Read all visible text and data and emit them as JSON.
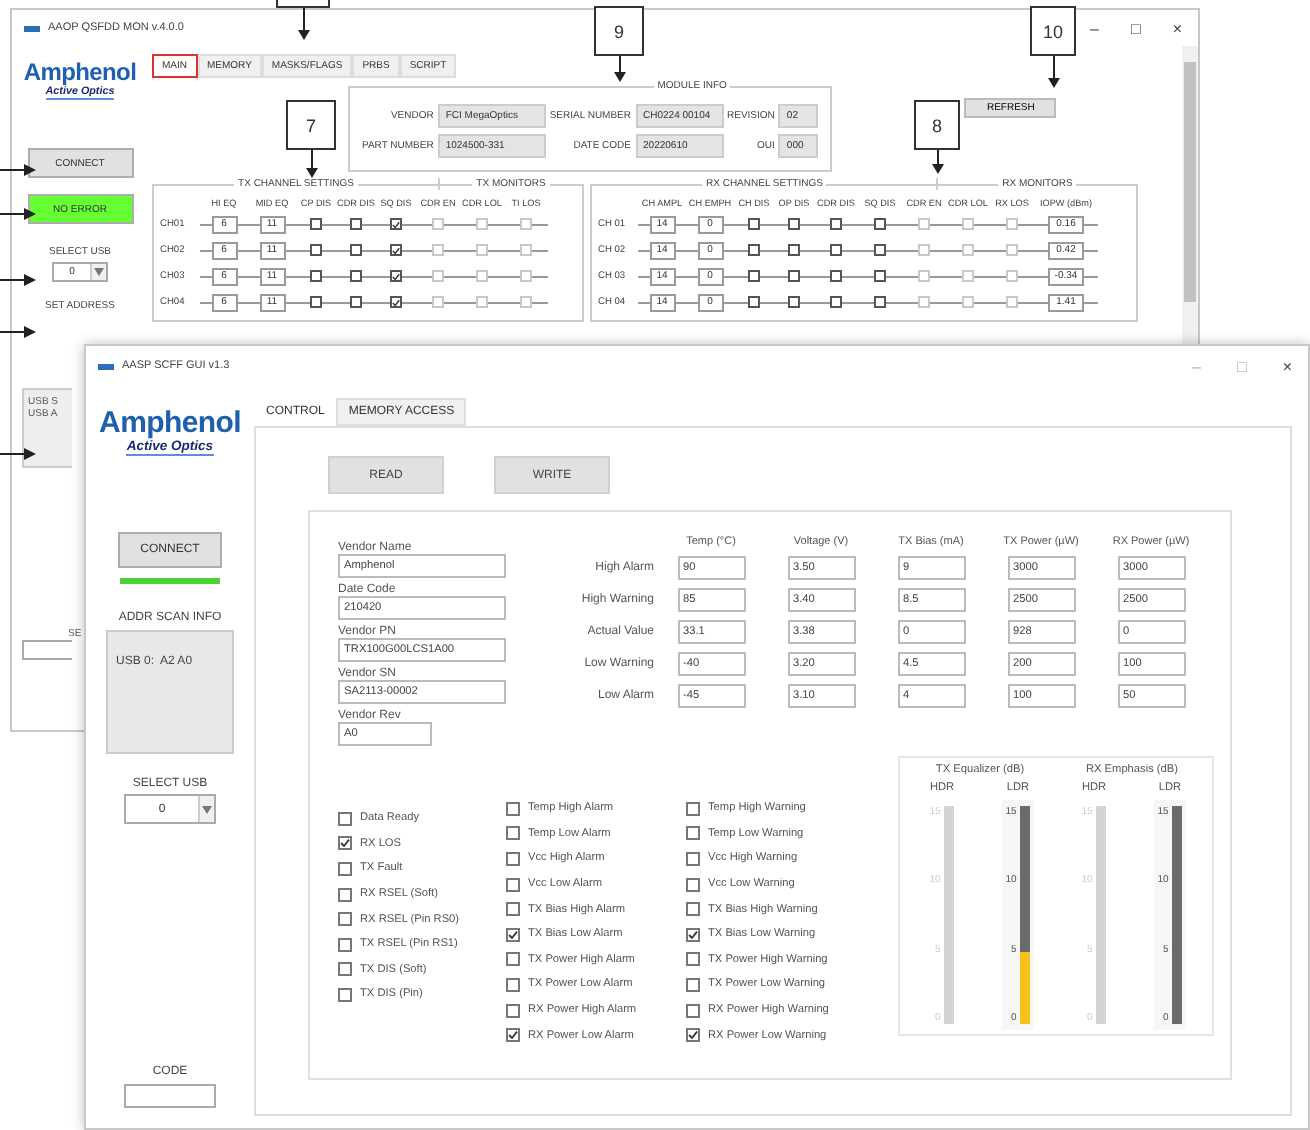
{
  "callouts": [
    {
      "kind": "partial"
    },
    {
      "kind": "numbered",
      "label": "9"
    },
    {
      "kind": "numbered",
      "label": "7"
    },
    {
      "kind": "numbered",
      "label": "8"
    },
    {
      "kind": "numbered",
      "label": "10"
    }
  ],
  "main_window": {
    "title": "AAOP QSFDD MON v.4.0.0",
    "controls": [
      "–",
      "□",
      "×"
    ],
    "logo": {
      "name": "Amphenol",
      "tagline": "Active Optics"
    },
    "tabs": [
      {
        "label": "MAIN",
        "selected": true
      },
      {
        "label": "MEMORY",
        "selected": false
      },
      {
        "label": "MASKS/FLAGS",
        "selected": false
      },
      {
        "label": "PRBS",
        "selected": false
      },
      {
        "label": "SCRIPT",
        "selected": false
      }
    ],
    "sidebar": {
      "connect": "CONNECT",
      "status": {
        "label": "NO ERROR",
        "ok": true
      },
      "select_usb": "SELECT USB",
      "usb_value": "0",
      "set_address": "SET ADDRESS",
      "scan_lines": [
        "USB S",
        "USB A"
      ],
      "cut_label": "SE"
    },
    "module_info": {
      "title": "MODULE INFO",
      "rows": [
        [
          {
            "label": "VENDOR",
            "value": "FCI MegaOptics"
          },
          {
            "label": "SERIAL NUMBER",
            "value": "CH0224 00104"
          },
          {
            "label": "REVISION",
            "value": "02"
          }
        ],
        [
          {
            "label": "PART NUMBER",
            "value": "1024500-331"
          },
          {
            "label": "DATE CODE",
            "value": "20220610"
          },
          {
            "label": "OUI",
            "value": "000"
          }
        ]
      ]
    },
    "refresh": "REFRESH",
    "tx": {
      "settings_title": "TX CHANNEL SETTINGS",
      "monitors_title": "TX MONITORS",
      "headers": [
        "HI EQ",
        "MID EQ",
        "CP DIS",
        "CDR DIS",
        "SQ DIS",
        "CDR EN",
        "CDR LOL",
        "TI LOS"
      ],
      "rows": [
        {
          "channel": "CH01",
          "cells": [
            {
              "kind": "value",
              "text": "6"
            },
            {
              "kind": "value",
              "text": "11"
            },
            {
              "kind": "check",
              "checked": false
            },
            {
              "kind": "check",
              "checked": false
            },
            {
              "kind": "check",
              "checked": true
            },
            {
              "kind": "led",
              "on": false
            },
            {
              "kind": "led",
              "on": false
            },
            {
              "kind": "led",
              "on": false
            }
          ]
        },
        {
          "channel": "CH02",
          "cells": [
            {
              "kind": "value",
              "text": "6"
            },
            {
              "kind": "value",
              "text": "11"
            },
            {
              "kind": "check",
              "checked": false
            },
            {
              "kind": "check",
              "checked": false
            },
            {
              "kind": "check",
              "checked": true
            },
            {
              "kind": "led",
              "on": false
            },
            {
              "kind": "led",
              "on": false
            },
            {
              "kind": "led",
              "on": false
            }
          ]
        },
        {
          "channel": "CH03",
          "cells": [
            {
              "kind": "value",
              "text": "6"
            },
            {
              "kind": "value",
              "text": "11"
            },
            {
              "kind": "check",
              "checked": false
            },
            {
              "kind": "check",
              "checked": false
            },
            {
              "kind": "check",
              "checked": true
            },
            {
              "kind": "led",
              "on": false
            },
            {
              "kind": "led",
              "on": false
            },
            {
              "kind": "led",
              "on": false
            }
          ]
        },
        {
          "channel": "CH04",
          "cells": [
            {
              "kind": "value",
              "text": "6"
            },
            {
              "kind": "value",
              "text": "11"
            },
            {
              "kind": "check",
              "checked": false
            },
            {
              "kind": "check",
              "checked": false
            },
            {
              "kind": "check",
              "checked": true
            },
            {
              "kind": "led",
              "on": false
            },
            {
              "kind": "led",
              "on": false
            },
            {
              "kind": "led",
              "on": false
            }
          ]
        }
      ]
    },
    "rx": {
      "settings_title": "RX CHANNEL SETTINGS",
      "monitors_title": "RX MONITORS",
      "headers": [
        "CH AMPL",
        "CH EMPH",
        "CH DIS",
        "OP DIS",
        "CDR DIS",
        "SQ DIS",
        "CDR EN",
        "CDR LOL",
        "RX LOS",
        "IOPW (dBm)"
      ],
      "rows": [
        {
          "channel": "CH 01",
          "cells": [
            {
              "kind": "value",
              "text": "14"
            },
            {
              "kind": "value",
              "text": "0"
            },
            {
              "kind": "check",
              "checked": false
            },
            {
              "kind": "check",
              "checked": false
            },
            {
              "kind": "check",
              "checked": false
            },
            {
              "kind": "check",
              "checked": false
            },
            {
              "kind": "led",
              "on": false
            },
            {
              "kind": "led",
              "on": false
            },
            {
              "kind": "led",
              "on": false
            },
            {
              "kind": "reading",
              "text": "0.16"
            }
          ]
        },
        {
          "channel": "CH 02",
          "cells": [
            {
              "kind": "value",
              "text": "14"
            },
            {
              "kind": "value",
              "text": "0"
            },
            {
              "kind": "check",
              "checked": false
            },
            {
              "kind": "check",
              "checked": false
            },
            {
              "kind": "check",
              "checked": false
            },
            {
              "kind": "check",
              "checked": false
            },
            {
              "kind": "led",
              "on": false
            },
            {
              "kind": "led",
              "on": false
            },
            {
              "kind": "led",
              "on": false
            },
            {
              "kind": "reading",
              "text": "0.42"
            }
          ]
        },
        {
          "channel": "CH 03",
          "cells": [
            {
              "kind": "value",
              "text": "14"
            },
            {
              "kind": "value",
              "text": "0"
            },
            {
              "kind": "check",
              "checked": false
            },
            {
              "kind": "check",
              "checked": false
            },
            {
              "kind": "check",
              "checked": false
            },
            {
              "kind": "check",
              "checked": false
            },
            {
              "kind": "led",
              "on": false
            },
            {
              "kind": "led",
              "on": false
            },
            {
              "kind": "led",
              "on": false
            },
            {
              "kind": "reading",
              "text": "-0.34"
            }
          ]
        },
        {
          "channel": "CH 04",
          "cells": [
            {
              "kind": "value",
              "text": "14"
            },
            {
              "kind": "value",
              "text": "0"
            },
            {
              "kind": "check",
              "checked": false
            },
            {
              "kind": "check",
              "checked": false
            },
            {
              "kind": "check",
              "checked": false
            },
            {
              "kind": "check",
              "checked": false
            },
            {
              "kind": "led",
              "on": false
            },
            {
              "kind": "led",
              "on": false
            },
            {
              "kind": "led",
              "on": false
            },
            {
              "kind": "reading",
              "text": "1.41"
            }
          ]
        }
      ]
    }
  },
  "scff_window": {
    "title": "AASP SCFF GUI v1.3",
    "controls": [
      "–",
      "□",
      "×"
    ],
    "logo": {
      "name": "Amphenol",
      "tagline": "Active Optics"
    },
    "connect": "CONNECT",
    "connected": true,
    "scan_title": "ADDR SCAN INFO",
    "scan_text": "USB 0:  A2 A0",
    "select_usb": "SELECT USB",
    "usb_value": "0",
    "code_label": "CODE",
    "tabs": [
      {
        "label": "CONTROL",
        "selected": true
      },
      {
        "label": "MEMORY ACCESS",
        "selected": false
      }
    ],
    "buttons": [
      "READ",
      "WRITE"
    ],
    "vendor_fields": [
      {
        "label": "Vendor Name",
        "value": "Amphenol"
      },
      {
        "label": "Date Code",
        "value": "210420"
      },
      {
        "label": "Vendor PN",
        "value": "TRX100G00LCS1A00"
      },
      {
        "label": "Vendor SN",
        "value": "SA2113-00002"
      },
      {
        "label": "Vendor Rev",
        "value": "A0"
      }
    ],
    "thresholds": {
      "columns": [
        "Temp (°C)",
        "Voltage (V)",
        "TX Bias (mA)",
        "TX Power (µW)",
        "RX Power (µW)"
      ],
      "rows": [
        {
          "label": "High Alarm",
          "values": [
            "90",
            "3.50",
            "9",
            "3000",
            "3000"
          ]
        },
        {
          "label": "High Warning",
          "values": [
            "85",
            "3.40",
            "8.5",
            "2500",
            "2500"
          ]
        },
        {
          "label": "Actual Value",
          "values": [
            "33.1",
            "3.38",
            "0",
            "928",
            "0"
          ]
        },
        {
          "label": "Low Warning",
          "values": [
            "-40",
            "3.20",
            "4.5",
            "200",
            "100"
          ]
        },
        {
          "label": "Low Alarm",
          "values": [
            "-45",
            "3.10",
            "4",
            "100",
            "50"
          ]
        }
      ]
    },
    "status_flags": [
      {
        "label": "Data Ready",
        "checked": false
      },
      {
        "label": "RX LOS",
        "checked": true
      },
      {
        "label": "TX Fault",
        "checked": false
      },
      {
        "label": "RX RSEL (Soft)",
        "checked": false
      },
      {
        "label": "RX RSEL (Pin RS0)",
        "checked": false
      },
      {
        "label": "TX RSEL (Pin RS1)",
        "checked": false
      },
      {
        "label": "TX DIS (Soft)",
        "checked": false
      },
      {
        "label": "TX DIS (Pin)",
        "checked": false
      }
    ],
    "alarm_flags": [
      {
        "label": "Temp High Alarm",
        "checked": false
      },
      {
        "label": "Temp Low Alarm",
        "checked": false
      },
      {
        "label": "Vcc High Alarm",
        "checked": false
      },
      {
        "label": "Vcc Low Alarm",
        "checked": false
      },
      {
        "label": "TX Bias High Alarm",
        "checked": false
      },
      {
        "label": "TX Bias Low Alarm",
        "checked": true
      },
      {
        "label": "TX Power High Alarm",
        "checked": false
      },
      {
        "label": "TX Power Low Alarm",
        "checked": false
      },
      {
        "label": "RX Power High Alarm",
        "checked": false
      },
      {
        "label": "RX Power Low Alarm",
        "checked": true
      }
    ],
    "warning_flags": [
      {
        "label": "Temp High Warning",
        "checked": false
      },
      {
        "label": "Temp Low Warning",
        "checked": false
      },
      {
        "label": "Vcc High Warning",
        "checked": false
      },
      {
        "label": "Vcc Low Warning",
        "checked": false
      },
      {
        "label": "TX Bias High Warning",
        "checked": false
      },
      {
        "label": "TX Bias Low Warning",
        "checked": true
      },
      {
        "label": "TX Power High Warning",
        "checked": false
      },
      {
        "label": "TX Power Low Warning",
        "checked": false
      },
      {
        "label": "RX Power High Warning",
        "checked": false
      },
      {
        "label": "RX Power Low Warning",
        "checked": true
      }
    ],
    "slider_groups": [
      {
        "title": "TX Equalizer (dB)",
        "sliders": [
          {
            "label": "HDR",
            "ticks": [
              "15",
              "10",
              "5",
              "0"
            ],
            "disabled": true
          },
          {
            "label": "LDR",
            "ticks": [
              "15",
              "10",
              "5",
              "0"
            ],
            "level": 0.33,
            "disabled": false
          }
        ]
      },
      {
        "title": "RX Emphasis (dB)",
        "sliders": [
          {
            "label": "HDR",
            "ticks": [
              "15",
              "10",
              "5",
              "0"
            ],
            "disabled": true
          },
          {
            "label": "LDR",
            "ticks": [
              "15",
              "10",
              "5",
              "0"
            ],
            "disabled": false
          }
        ]
      }
    ]
  }
}
